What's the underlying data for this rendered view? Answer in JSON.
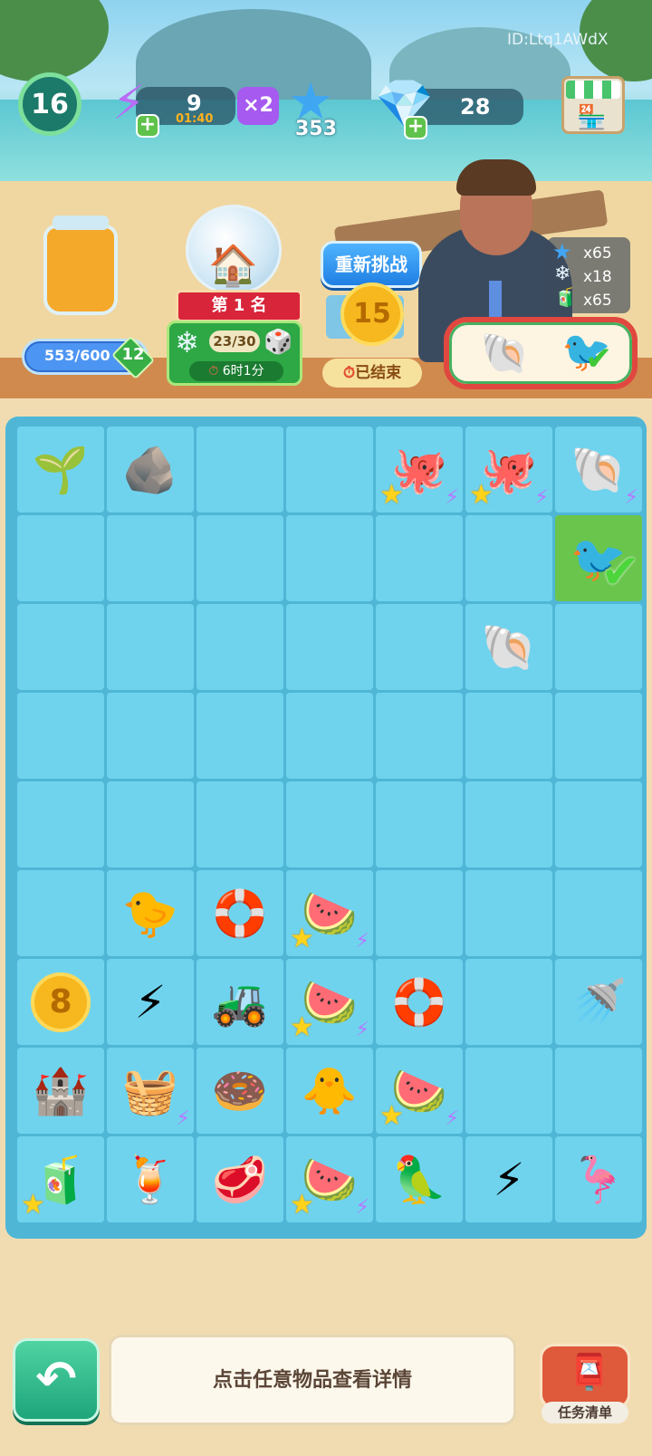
{
  "hud": {
    "id_label": "ID:Ltq1AWdX",
    "level": "16",
    "energy": "9",
    "energy_timer": "01:40",
    "multiplier": "×2",
    "stars": "353",
    "gems": "28"
  },
  "jar": {
    "progress": "553/600",
    "badge": "12",
    "fill": 0.92
  },
  "event": {
    "rank": "第 1 名",
    "snow": "23/30",
    "time": "6时1分"
  },
  "challenge": {
    "retry_label": "重新挑战",
    "coin": "15",
    "ended_label": "已结束"
  },
  "reward": {
    "star_qty": "x65",
    "snow_qty": "x18",
    "drink_qty": "x65"
  },
  "order": {
    "items": [
      "shell-icon",
      "bird-icon"
    ]
  },
  "board": {
    "rows": [
      [
        "🌱",
        "🪨",
        "",
        "",
        "🐙",
        "🐙",
        "🐚"
      ],
      [
        "",
        "",
        "",
        "",
        "",
        "",
        "🐦"
      ],
      [
        "",
        "",
        "",
        "",
        "",
        "🐚",
        ""
      ],
      [
        "",
        "",
        "",
        "",
        "",
        "",
        ""
      ],
      [
        "",
        "",
        "",
        "",
        "",
        "",
        ""
      ],
      [
        "",
        "🐤",
        "🛟",
        "🍉",
        "",
        "",
        ""
      ],
      [
        "8",
        "⚡",
        "🚜",
        "🍉",
        "🛟",
        "",
        "🚿"
      ],
      [
        "🏰",
        "🧺",
        "🍩",
        "🐥",
        "🍉",
        "",
        ""
      ],
      [
        "🧃",
        "🍹",
        "🥩",
        "🍉",
        "🦜",
        "⚡",
        "🦩"
      ]
    ]
  },
  "bottom": {
    "hint": "点击任意物品查看详情",
    "tasks_label": "任务清单"
  },
  "colors": {
    "board": "#4fb6d6",
    "cell": "#6fd3ee",
    "selected": "#6ac54c",
    "accent": "#ffd21c"
  }
}
